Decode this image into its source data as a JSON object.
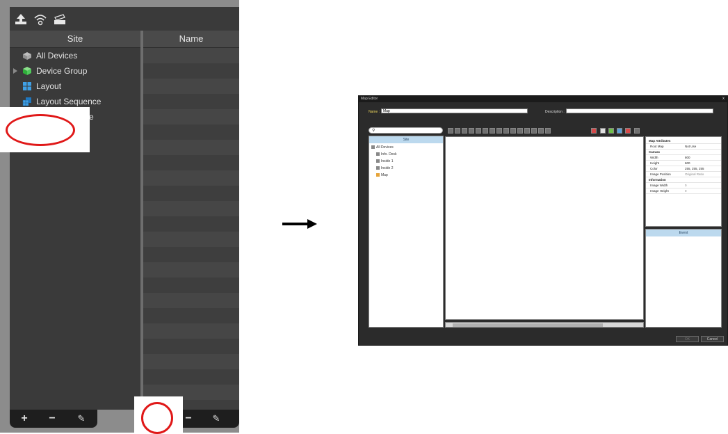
{
  "toolbar": {
    "icons": [
      "upload-icon",
      "wireless-icon",
      "device-icon"
    ]
  },
  "columns": {
    "site": "Site",
    "name": "Name"
  },
  "tree": {
    "items": [
      {
        "label": "All Devices",
        "icon": "all-devices-icon",
        "expandable": false
      },
      {
        "label": "Device Group",
        "icon": "device-group-icon",
        "expandable": true
      },
      {
        "label": "Layout",
        "icon": "layout-icon",
        "expandable": false
      },
      {
        "label": "Layout Sequence",
        "icon": "layout-sequence-icon",
        "expandable": false
      },
      {
        "label": "ce",
        "icon": "",
        "expandable": false
      }
    ]
  },
  "bottom_bar": {
    "add": "+",
    "remove": "−",
    "edit": "✎"
  },
  "map_editor": {
    "title": "Map Editor",
    "close": "x",
    "name_label": "Name :",
    "name_value": "Map",
    "description_label": "Description :",
    "description_value": "",
    "search_icon": "⚲",
    "site_header": "Site",
    "site_tree": [
      "All Devices",
      "Info. Desk",
      "Inside 1",
      "Inside 2",
      "Map"
    ],
    "attributes": [
      {
        "key": "Map Attributes",
        "value": "",
        "group": true
      },
      {
        "key": "Root Map",
        "value": "Not Use",
        "group": false
      },
      {
        "key": "Canvas",
        "value": "",
        "group": true
      },
      {
        "key": "Width",
        "value": "800",
        "group": false
      },
      {
        "key": "Height",
        "value": "600",
        "group": false
      },
      {
        "key": "Color",
        "value": "255, 255, 255",
        "group": false
      },
      {
        "key": "Image Position",
        "value": "Original Ratio",
        "group": false
      },
      {
        "key": "Information",
        "value": "",
        "group": true
      },
      {
        "key": "Image Width",
        "value": "0",
        "group": false
      },
      {
        "key": "Image Height",
        "value": "0",
        "group": false
      }
    ],
    "event_header": "Event",
    "ok_label": "OK",
    "cancel_label": "Cancel"
  },
  "colors": {
    "panel_dark": "#3a3a3a",
    "highlight_red": "#e01818",
    "editor_header_blue": "#bcd9ee"
  }
}
